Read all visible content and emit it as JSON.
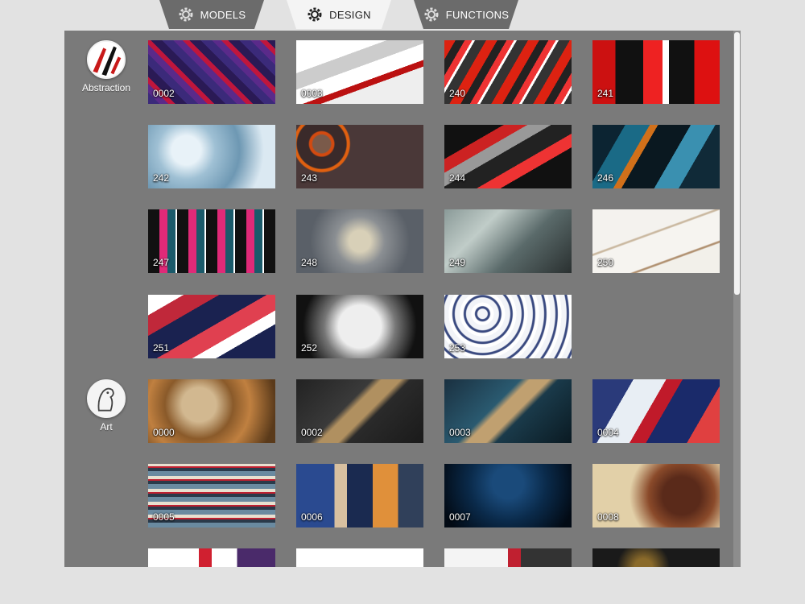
{
  "tabs": [
    {
      "label": "MODELS"
    },
    {
      "label": "DESIGN"
    },
    {
      "label": "FUNCTIONS"
    }
  ],
  "categories": [
    {
      "label": "Abstraction"
    },
    {
      "label": "Art"
    }
  ],
  "tiles": [
    {
      "code": "0002",
      "icon": "abstract-pattern"
    },
    {
      "code": "0003",
      "icon": "abstract-pattern"
    },
    {
      "code": "240",
      "icon": "abstract-pattern"
    },
    {
      "code": "241",
      "icon": "abstract-pattern"
    },
    {
      "code": "242",
      "icon": "abstract-pattern"
    },
    {
      "code": "243",
      "icon": "lava-pattern"
    },
    {
      "code": "244",
      "icon": "abstract-pattern"
    },
    {
      "code": "246",
      "icon": "abstract-pattern"
    },
    {
      "code": "247",
      "icon": "abstract-pattern"
    },
    {
      "code": "248",
      "icon": "cracked-pattern"
    },
    {
      "code": "249",
      "icon": "grunge-pattern"
    },
    {
      "code": "250",
      "icon": "marble-pattern"
    },
    {
      "code": "251",
      "icon": "abstract-pattern"
    },
    {
      "code": "252",
      "icon": "grunge-pattern"
    },
    {
      "code": "253",
      "icon": "floral-pattern"
    },
    {
      "code": "0000",
      "icon": "art-pattern"
    },
    {
      "code": "0002",
      "icon": "art-pattern"
    },
    {
      "code": "0003",
      "icon": "art-pattern"
    },
    {
      "code": "0004",
      "icon": "art-pattern"
    },
    {
      "code": "0005",
      "icon": "art-pattern"
    },
    {
      "code": "0006",
      "icon": "art-pattern"
    },
    {
      "code": "0007",
      "icon": "art-pattern"
    },
    {
      "code": "0008",
      "icon": "art-pattern"
    }
  ],
  "colors": {
    "panel": "#7a7a7a",
    "tab": "#6e6e6e",
    "tab_active": "#f4f4f4",
    "background": "#e2e2e2"
  }
}
